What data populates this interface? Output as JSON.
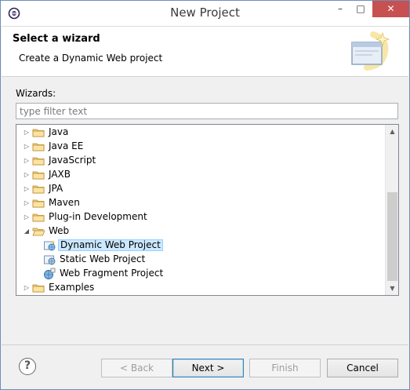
{
  "window": {
    "title": "New Project"
  },
  "banner": {
    "title": "Select a wizard",
    "description": "Create a Dynamic Web project",
    "graphic_icon": "wizard-banner-icon"
  },
  "wizards": {
    "label": "Wizards:",
    "filter_placeholder": "type filter text",
    "filter_value": ""
  },
  "tree": {
    "items": [
      {
        "label": "Java",
        "expanded": false,
        "level": 0,
        "icon": "folder-icon"
      },
      {
        "label": "Java EE",
        "expanded": false,
        "level": 0,
        "icon": "folder-icon"
      },
      {
        "label": "JavaScript",
        "expanded": false,
        "level": 0,
        "icon": "folder-icon"
      },
      {
        "label": "JAXB",
        "expanded": false,
        "level": 0,
        "icon": "folder-icon"
      },
      {
        "label": "JPA",
        "expanded": false,
        "level": 0,
        "icon": "folder-icon"
      },
      {
        "label": "Maven",
        "expanded": false,
        "level": 0,
        "icon": "folder-icon"
      },
      {
        "label": "Plug-in Development",
        "expanded": false,
        "level": 0,
        "icon": "folder-icon"
      },
      {
        "label": "Web",
        "expanded": true,
        "level": 0,
        "icon": "folder-open-icon"
      },
      {
        "label": "Dynamic Web Project",
        "level": 1,
        "icon": "dynamic-web-project-icon",
        "selected": true
      },
      {
        "label": "Static Web Project",
        "level": 1,
        "icon": "static-web-project-icon"
      },
      {
        "label": "Web Fragment Project",
        "level": 1,
        "icon": "web-fragment-project-icon"
      },
      {
        "label": "Examples",
        "expanded": false,
        "level": 0,
        "icon": "folder-icon"
      }
    ]
  },
  "buttons": {
    "help": "?",
    "back": "< Back",
    "next": "Next >",
    "finish": "Finish",
    "cancel": "Cancel"
  },
  "window_controls": {
    "minimize": "–",
    "maximize": "□",
    "close": "✕"
  }
}
